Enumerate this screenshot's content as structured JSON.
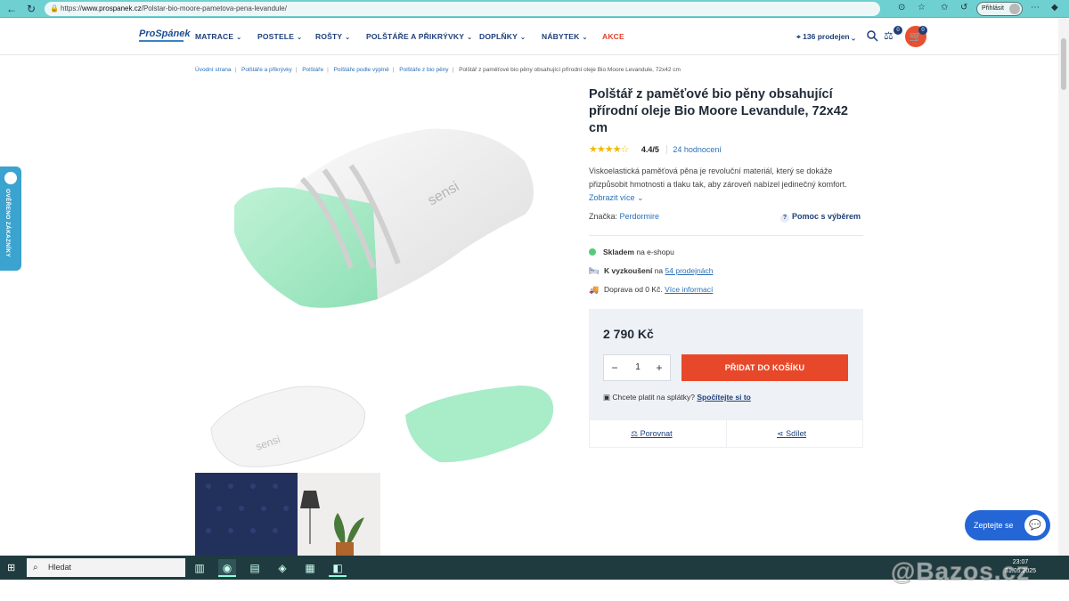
{
  "browser": {
    "url_prefix": "https://",
    "url_domain": "www.prospanek.cz",
    "url_path": "/Polstar-bio-moore-pametova-pena-levandule/",
    "login_label": "Přihlásit"
  },
  "nav": {
    "logo": "ProSpánek",
    "menu": [
      "MATRACE",
      "POSTELE",
      "ROŠTY",
      "POLŠTÁŘE A PŘIKRÝVKY",
      "DOPLŇKY",
      "NÁBYTEK",
      "AKCE"
    ],
    "stores": "136 prodejen",
    "compare_count": "0",
    "cart_count": "0"
  },
  "breadcrumb": [
    "Úvodní strana",
    "Polštáře a přikrývky",
    "Polštáře",
    "Polštáře podle výplně",
    "Polštáře z bio pěny",
    "Polštář z paměťové bio pěny obsahující přírodní oleje Bio Moore Levandule, 72x42 cm"
  ],
  "product": {
    "title": "Polštář z paměťové bio pěny obsahující přírodní oleje Bio Moore Levandule, 72x42 cm",
    "stars": "★★★★☆",
    "rating_value": 4.4,
    "rating": "4.4/5",
    "reviews": "24 hodnocení",
    "description": "Viskoelastická paměťová pěna je revoluční materiál, který se dokáže přizpůsobit hmotnosti a tlaku tak, aby zároveň nabízel jedinečný komfort.",
    "show_more": "Zobrazit více",
    "brand_label": "Značka:",
    "brand": "Perdormire",
    "help": "Pomoc s výběrem",
    "stock_bold": "Skladem",
    "stock_rest": "na e-shopu",
    "try_bold": "K vyzkoušení",
    "try_mid": "na",
    "try_link": "54 prodejnách",
    "delivery": "Doprava od 0 Kč.",
    "delivery_link": "Více informací",
    "price": "2 790 Kč",
    "qty": "1",
    "add_to_cart": "PŘIDAT DO KOŠÍKU",
    "installment_text": "Chcete platit na splátky?",
    "installment_link": "Spočítejte si to",
    "compare": "Porovnat",
    "share": "Sdílet"
  },
  "side_tab": "OVĚŘENO ZÁKAZNÍKY",
  "chat": "Zeptejte se",
  "taskbar": {
    "search": "Hledat",
    "time": "23:07",
    "date": "31.05.2025"
  },
  "watermark": "@Bazos.cz",
  "colors": {
    "accent": "#e8482a",
    "brand_blue": "#1d3f7a",
    "link": "#2a6fb8",
    "browser_bar": "#6fd0d2"
  }
}
